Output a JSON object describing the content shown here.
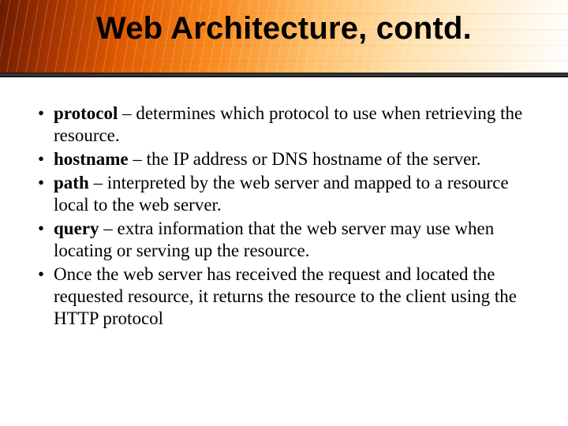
{
  "slide": {
    "title": "Web Architecture, contd."
  },
  "bullets": [
    {
      "term": "protocol",
      "rest": " – determines which protocol to use when retrieving the resource."
    },
    {
      "term": "hostname",
      "rest": " – the IP address or DNS hostname of the server."
    },
    {
      "term": "path",
      "rest": " – interpreted by the web server and mapped to a resource local to the web server."
    },
    {
      "term": "query",
      "rest": " – extra information that the web server may use when locating or serving up the resource."
    },
    {
      "term": "",
      "rest": "Once the web server has received the request and located the requested resource, it returns the resource to the client using the HTTP protocol"
    }
  ]
}
